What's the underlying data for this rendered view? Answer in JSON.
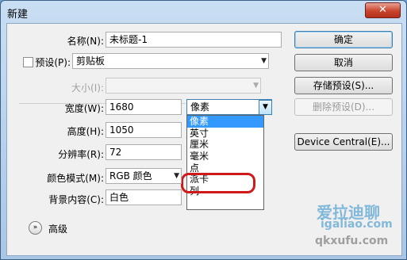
{
  "window": {
    "title": "新建",
    "close_glyph": "✕"
  },
  "form": {
    "name_label": "名称(N):",
    "name_value": "未标题-1",
    "preset_label": "预设(P):",
    "preset_value": "剪贴板",
    "size_label": "大小(I):",
    "size_value": "",
    "width_label": "宽度(W):",
    "width_value": "1680",
    "width_unit": "像素",
    "height_label": "高度(H):",
    "height_value": "1050",
    "resolution_label": "分辨率(R):",
    "resolution_value": "72",
    "color_mode_label": "颜色模式(M):",
    "color_mode_value": "RGB 颜色",
    "background_label": "背景内容(C):",
    "background_value": "白色",
    "advanced_label": "高级"
  },
  "unit_dropdown": {
    "options": [
      "像素",
      "英寸",
      "厘米",
      "毫米",
      "点",
      "派卡",
      "列"
    ],
    "selected_index": 0,
    "highlighted_option": "毫米"
  },
  "buttons": {
    "ok": "确定",
    "cancel": "取消",
    "save_preset": "存储预设(S)...",
    "delete_preset": "删除预设(D)...",
    "device_central": "Device Central(E)..."
  },
  "watermark": {
    "line1": "爱拉迪聊",
    "line2": "igaliao.com",
    "line3": "qkxufu.com"
  },
  "colors": {
    "selection": "#3399ff",
    "highlight_circle": "#d01a1a",
    "title_bar": "#c9def3"
  }
}
